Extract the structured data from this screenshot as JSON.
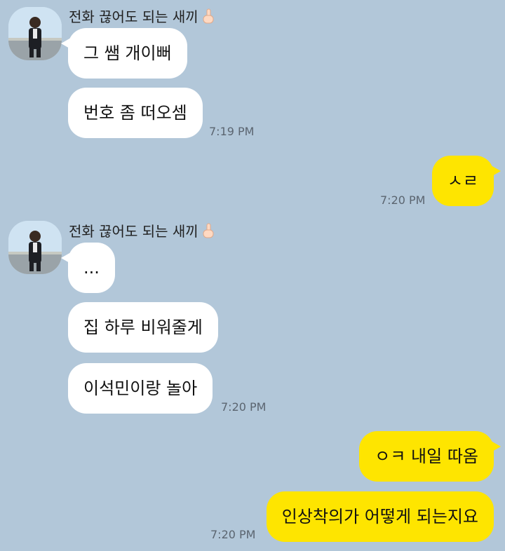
{
  "chat": {
    "sender_name": "전화 끊어도 되는 새끼",
    "groups": [
      {
        "messages": [
          "그 쌤 개이뻐",
          "번호 좀 떠오셈"
        ],
        "time": "7:19 PM"
      },
      {
        "messages": [
          "ㅅㄹ"
        ],
        "time": "7:20 PM"
      },
      {
        "messages": [
          "...",
          "집 하루 비워줄게",
          "이석민이랑 놀아"
        ],
        "time": "7:20 PM"
      },
      {
        "messages": [
          "ㅇㅋ 내일 따옴",
          "인상착의가 어떻게 되는지요"
        ],
        "time": "7:20 PM"
      }
    ]
  },
  "colors": {
    "background": "#b2c7d9",
    "incoming_bubble": "#ffffff",
    "outgoing_bubble": "#fee500"
  },
  "icons": {
    "sender_emoji": "middle-finger-icon",
    "avatar": "avatar"
  }
}
